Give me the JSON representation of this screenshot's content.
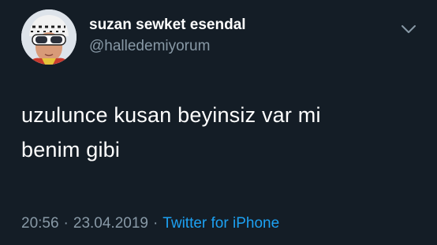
{
  "author": {
    "display_name": "suzan sewket esendal",
    "handle": "@halledemiyorum",
    "avatar_icon": "profile-photo"
  },
  "menu": {
    "icon": "chevron-down-icon"
  },
  "tweet": {
    "lines": [
      "uzulunce kusan beyinsiz var mi",
      "benim gibi"
    ]
  },
  "meta": {
    "time": "20:56",
    "separator_1": "·",
    "date": "23.04.2019",
    "separator_2": "·",
    "source": "Twitter for iPhone"
  },
  "colors": {
    "background": "#141d26",
    "text_primary": "#ffffff",
    "text_secondary": "#8899a6",
    "link": "#1da1f2"
  }
}
